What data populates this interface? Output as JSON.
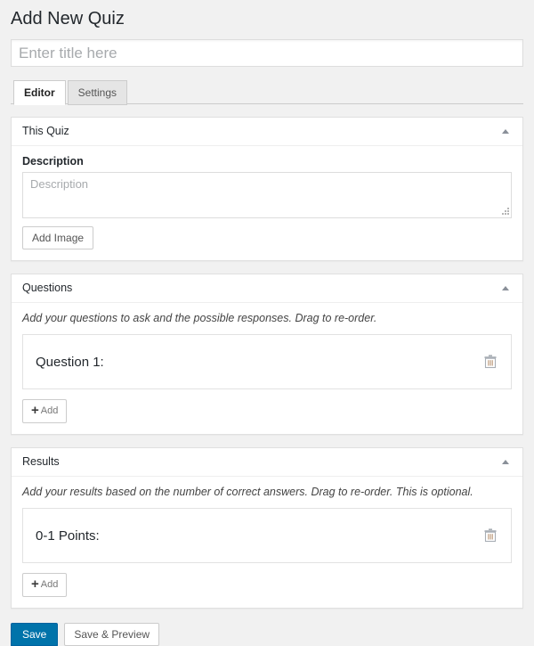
{
  "page": {
    "title": "Add New Quiz"
  },
  "title_field": {
    "value": "",
    "placeholder": "Enter title here"
  },
  "tabs": [
    {
      "label": "Editor",
      "active": true
    },
    {
      "label": "Settings",
      "active": false
    }
  ],
  "panels": [
    {
      "heading": "This Quiz",
      "toggle_icon": "caret-up-icon",
      "description_label": "Description",
      "description_value": "",
      "description_placeholder": "Description",
      "add_image_label": "Add Image"
    },
    {
      "heading": "Questions",
      "toggle_icon": "caret-up-icon",
      "helper": "Add your questions to ask and the possible responses. Drag to re-order.",
      "items": [
        {
          "label": "Question 1:",
          "delete_icon": "trash-icon"
        }
      ],
      "add_plus": "+",
      "add_label": "Add"
    },
    {
      "heading": "Results",
      "toggle_icon": "caret-up-icon",
      "helper": "Add your results based on the number of correct answers. Drag to re-order. This is optional.",
      "items": [
        {
          "label": "0-1 Points:",
          "delete_icon": "trash-icon"
        }
      ],
      "add_plus": "+",
      "add_label": "Add"
    }
  ],
  "actions": {
    "save_label": "Save",
    "save_preview_label": "Save & Preview"
  },
  "colors": {
    "primary": "#0073aa",
    "page_background": "#f1f1f1",
    "panel_background": "#ffffff",
    "border": "#e0e0e0"
  }
}
